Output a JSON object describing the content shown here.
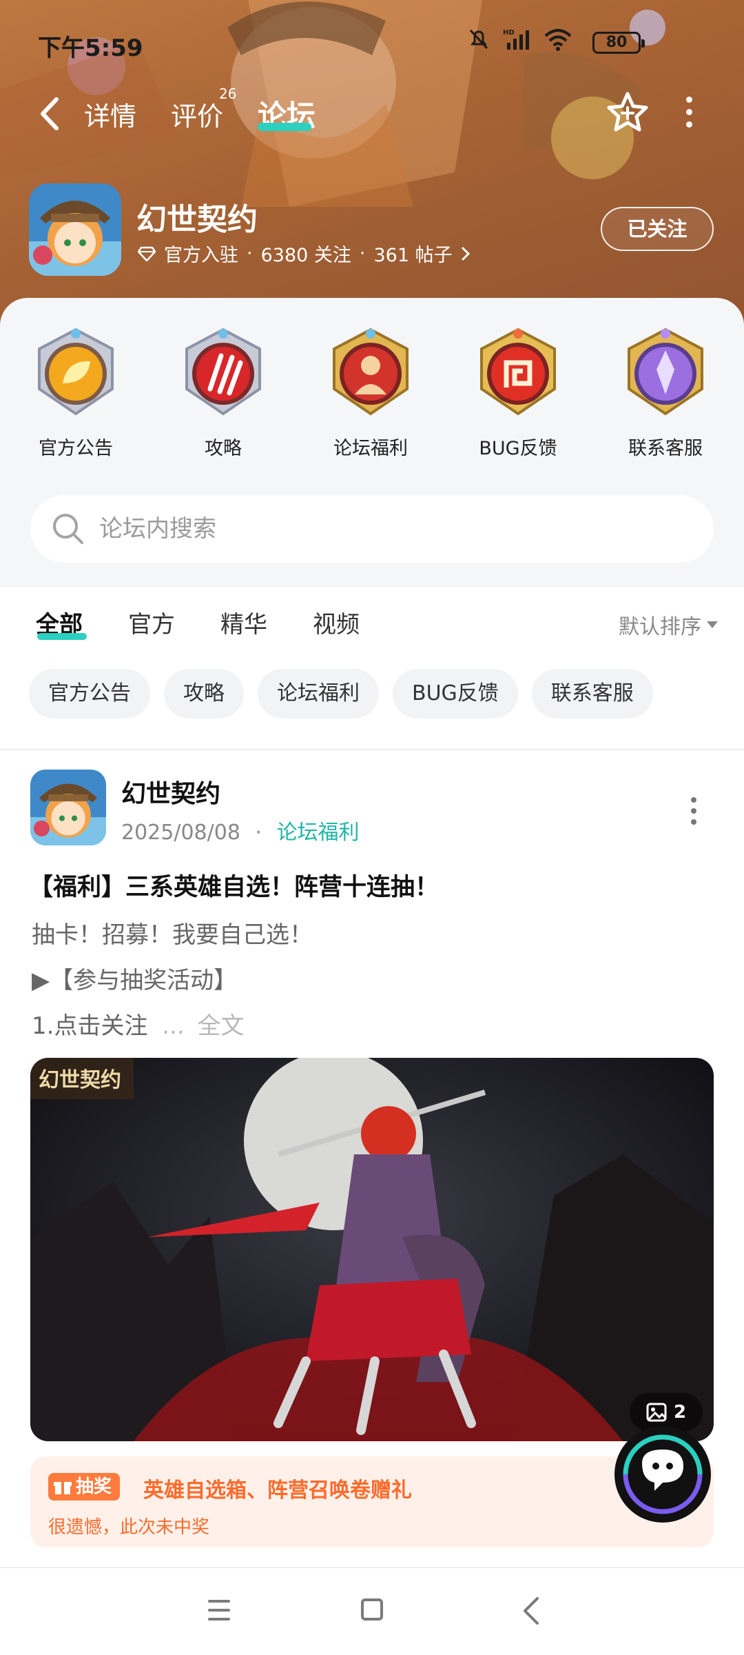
{
  "status_bar": {
    "time": "下午5:59",
    "battery": "80"
  },
  "nav": {
    "tabs": [
      {
        "label": "详情"
      },
      {
        "label": "评价",
        "badge": "26"
      },
      {
        "label": "论坛",
        "active": true
      }
    ]
  },
  "game": {
    "name": "幻世契约",
    "official_label": "官方入驻",
    "followers": "6380 关注",
    "posts": "361 帖子",
    "follow_button": "已关注"
  },
  "categories": [
    {
      "label": "官方公告",
      "icon": "leaf-emblem-icon",
      "color": "#f0a01a"
    },
    {
      "label": "攻略",
      "icon": "claw-emblem-icon",
      "color": "#d8272a"
    },
    {
      "label": "论坛福利",
      "icon": "hero-emblem-icon",
      "color": "#d2332a"
    },
    {
      "label": "BUG反馈",
      "icon": "spiral-emblem-icon",
      "color": "#e02f24"
    },
    {
      "label": "联系客服",
      "icon": "crystal-emblem-icon",
      "color": "#9b6fe0"
    }
  ],
  "search": {
    "placeholder": "论坛内搜索"
  },
  "filter_tabs": [
    {
      "label": "全部",
      "active": true
    },
    {
      "label": "官方"
    },
    {
      "label": "精华"
    },
    {
      "label": "视频"
    }
  ],
  "sort": {
    "label": "默认排序"
  },
  "chips": [
    "官方公告",
    "攻略",
    "论坛福利",
    "BUG反馈",
    "联系客服"
  ],
  "post": {
    "author": "幻世契约",
    "date": "2025/08/08",
    "separator": "·",
    "tag": "论坛福利",
    "title": "【福利】三系英雄自选！阵营十连抽！",
    "lines": [
      "抽卡！招募！我要自己选！",
      "▶【参与抽奖活动】",
      "1.点击关注"
    ],
    "ellipsis": "...",
    "more": "全文",
    "image_logo": "幻世契约",
    "image_count": "2",
    "lottery": {
      "badge": "抽奖",
      "prize": "英雄自选箱、阵营召唤卷赠礼",
      "result": "很遗憾，此次未中奖"
    }
  },
  "colors": {
    "accent": "#2bd0c0",
    "tag": "#20b7a7",
    "lottery": "#ff6a2b",
    "hero_bg": "#b8703c"
  }
}
